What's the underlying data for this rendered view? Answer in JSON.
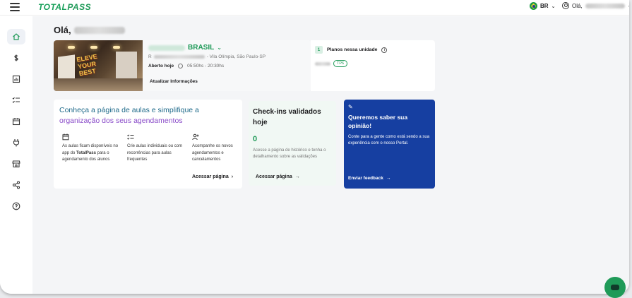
{
  "topbar": {
    "logo_total": "TOTAL",
    "logo_pass": "PASS",
    "language": "BR",
    "user_greeting": "Olá,"
  },
  "main": {
    "greeting": "Olá,"
  },
  "unit": {
    "name": "BRASIL",
    "address_prefix": "R",
    "address_suffix": "- Vila Olímpia, São Paulo-SP",
    "open_label": "Aberto hoje",
    "hours": "05:50hs - 20:30hs",
    "update_label": "Atualizar Informações"
  },
  "plans": {
    "count": "1",
    "title": "Planos nessa unidade",
    "plan_badge": "TP6"
  },
  "aulas": {
    "title_part1": "Conheça a página de aulas e simplifique a",
    "title_part2": "organização dos seus agendamentos",
    "features": [
      {
        "text": "As aulas ficam disponíveis no app do ",
        "bold": "TotalPass",
        "text2": " para o agendamento dos alunos"
      },
      {
        "text": "Crie aulas individuais ou com recorrências para aulas frequentes",
        "bold": "",
        "text2": ""
      },
      {
        "text": "Acompanhe os novos agendamentos e cancelamentos",
        "bold": "",
        "text2": ""
      }
    ],
    "link": "Acessar página"
  },
  "checkin": {
    "title": "Check-ins validados hoje",
    "count": "0",
    "description": "Acesse a página de histórico e tenha o detalhamento sobre as validações",
    "link": "Acessar página"
  },
  "feedback": {
    "title": "Queremos saber sua opinião!",
    "description": "Conte para a gente como está sendo a sua experiência com o nosso Portal.",
    "link": "Enviar feedback"
  },
  "colors": {
    "brand_green": "#1f9a58",
    "feedback_blue": "#163fa1",
    "main_bg": "#f4f5f7"
  }
}
